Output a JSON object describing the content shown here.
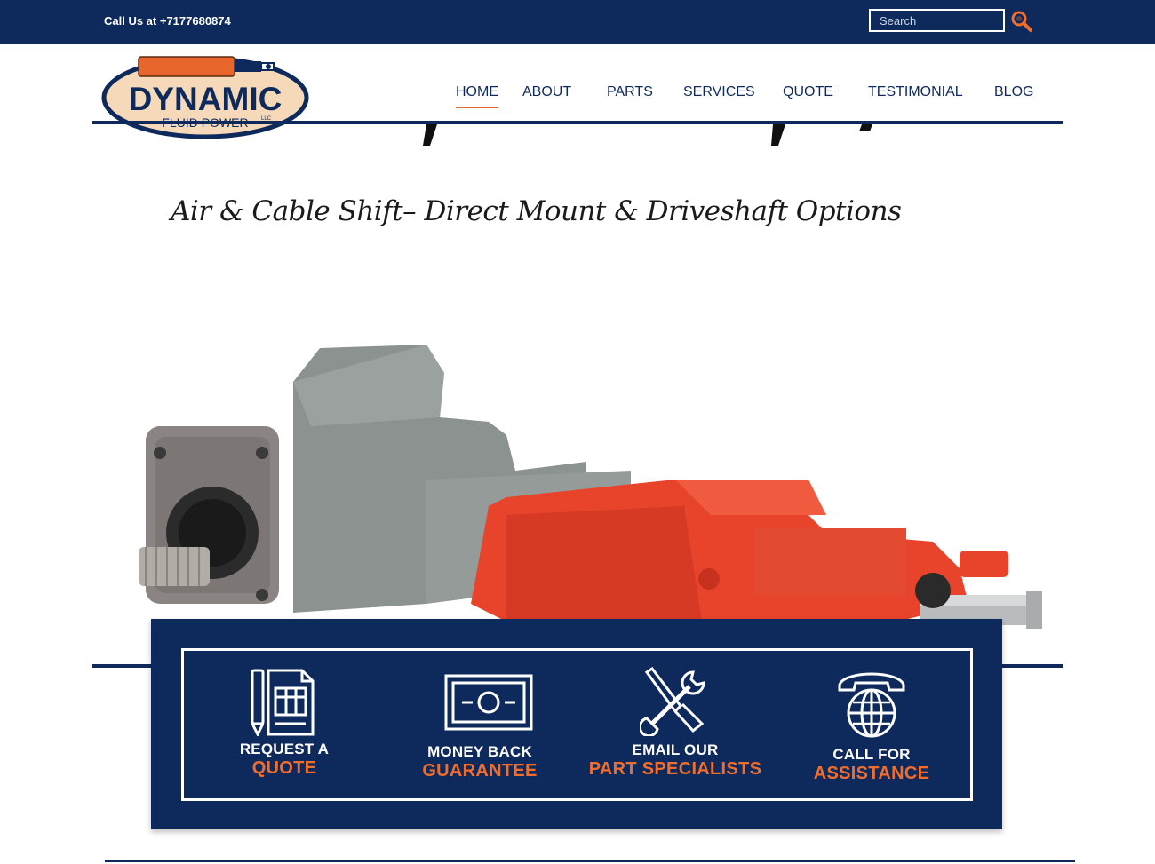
{
  "topbar": {
    "phone_text": "Call Us at +7177680874",
    "search_placeholder": "Search"
  },
  "logo": {
    "name": "DYNAMIC",
    "tagline": "FLUID POWER",
    "suffix": "LLC"
  },
  "nav": {
    "items": [
      {
        "label": "HOME",
        "active": true
      },
      {
        "label": "ABOUT",
        "active": false
      },
      {
        "label": "PARTS",
        "active": false
      },
      {
        "label": "SERVICES",
        "active": false
      },
      {
        "label": "QUOTE",
        "active": false
      },
      {
        "label": "TESTIMONIAL",
        "active": false
      },
      {
        "label": "BLOG",
        "active": false
      }
    ]
  },
  "hero": {
    "subtitle": "Air & Cable Shift– Direct Mount & Driveshaft Options"
  },
  "features": [
    {
      "line1": "REQUEST A",
      "line2": "QUOTE",
      "icon": "document-icon"
    },
    {
      "line1": "MONEY BACK",
      "line2": "GUARANTEE",
      "icon": "banknote-icon"
    },
    {
      "line1": "EMAIL OUR",
      "line2": "PART SPECIALISTS",
      "icon": "tools-icon"
    },
    {
      "line1": "CALL FOR",
      "line2": "ASSISTANCE",
      "icon": "phone-globe-icon"
    }
  ],
  "colors": {
    "navy": "#0e2a5c",
    "accent": "#f26d2c"
  }
}
